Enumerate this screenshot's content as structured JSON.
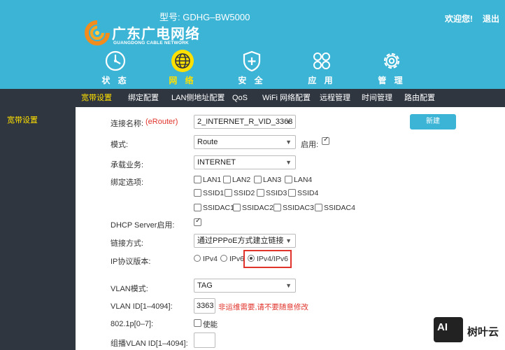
{
  "header": {
    "model": "型号: GDHG–BW5000",
    "logo_cn": "广东广电网络",
    "logo_en": "GUANGDONG CABLE NETWORK",
    "welcome": "欢迎您!",
    "logout": "退出",
    "accent": "#3bb4d6",
    "active_color": "#ffe000"
  },
  "nav": [
    {
      "label": "状 态",
      "icon": "dashboard-gauge-icon"
    },
    {
      "label": "网 络",
      "icon": "globe-icon",
      "active": true
    },
    {
      "label": "安 全",
      "icon": "shield-plus-icon"
    },
    {
      "label": "应 用",
      "icon": "apps-grid-icon"
    },
    {
      "label": "管 理",
      "icon": "gear-icon"
    }
  ],
  "subnav": [
    "宽带设置",
    "绑定配置",
    "LAN侧地址配置",
    "QoS",
    "WiFi 网络配置",
    "远程管理",
    "时间管理",
    "路由配置"
  ],
  "sidebar": {
    "item": "宽带设置"
  },
  "form": {
    "conn_name_label": "连接名称:",
    "erouter": "(eRouter)",
    "conn_name_value": "2_INTERNET_R_VID_3363",
    "new_button": "新建",
    "mode_label": "模式:",
    "mode_value": "Route",
    "enable_label": "启用:",
    "service_label": "承载业务:",
    "service_value": "INTERNET",
    "bind_label": "绑定选项:",
    "bind_options": [
      "LAN1",
      "LAN2",
      "LAN3",
      "LAN4",
      "SSID1",
      "SSID2",
      "SSID3",
      "SSID4",
      "SSIDAC1",
      "SSIDAC2",
      "SSIDAC3",
      "SSIDAC4"
    ],
    "dhcp_label": "DHCP Server启用:",
    "link_label": "链接方式:",
    "link_value": "通过PPPoE方式建立链接",
    "ip_label": "IP协议版本:",
    "ip_options": [
      "IPv4",
      "IPv6",
      "IPv4/IPv6"
    ],
    "vlan_mode_label": "VLAN模式:",
    "vlan_mode_value": "TAG",
    "vlan_id_label": "VLAN ID[1–4094]:",
    "vlan_id_value": "3363",
    "vlan_warn": "非运维需要,请不要随意修改",
    "p8021_label": "802.1p[0–7]:",
    "p8021_enable": "使能",
    "group_vlan_label": "组播VLAN ID[1–4094]:",
    "group_vlan_value": ""
  },
  "watermark": {
    "badge": "AI",
    "text": "树叶云"
  }
}
